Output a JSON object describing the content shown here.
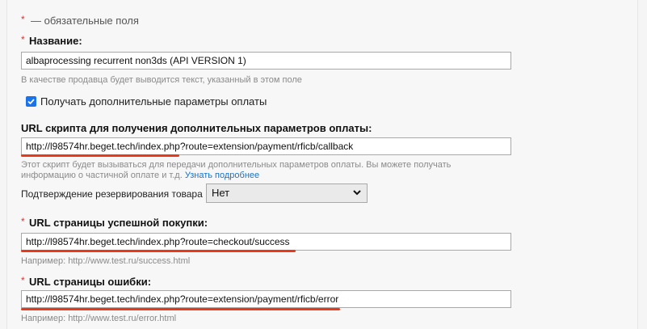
{
  "legend": {
    "star": "*",
    "text": "— обязательные поля"
  },
  "name_field": {
    "star": "*",
    "label": "Название:",
    "value": "albaprocessing recurrent non3ds (API VERSION 1)",
    "hint": "В качестве продавца будет выводится текст, указанный в этом поле"
  },
  "extra_params": {
    "checkbox_label": "Получать дополнительные параметры оплаты",
    "checked": true
  },
  "callback_url": {
    "label": "URL скрипта для получения дополнительных параметров оплаты:",
    "value": "http://l98574hr.beget.tech/index.php?route=extension/payment/rficb/callback",
    "hint_line1": "Этот скрипт будет вызываться для передачи дополнительных параметров оплаты. Вы можете получать",
    "hint_line2": "информацию о частичной оплате и т.д.",
    "hint_link": "Узнать подробнее"
  },
  "reservation": {
    "label": "Подтверждение резервирования товара",
    "selected": "Нет"
  },
  "success_url": {
    "star": "*",
    "label": "URL страницы успешной покупки:",
    "value": "http://l98574hr.beget.tech/index.php?route=checkout/success",
    "hint": "Например: http://www.test.ru/success.html"
  },
  "error_url": {
    "star": "*",
    "label": "URL страницы ошибки:",
    "value": "http://l98574hr.beget.tech/index.php?route=extension/payment/rficb/error",
    "hint": "Например: http://www.test.ru/error.html"
  },
  "colors": {
    "underline": "#e8391a",
    "link": "#1a73c8",
    "checkbox": "#1a73e8",
    "required": "#dd3333"
  }
}
